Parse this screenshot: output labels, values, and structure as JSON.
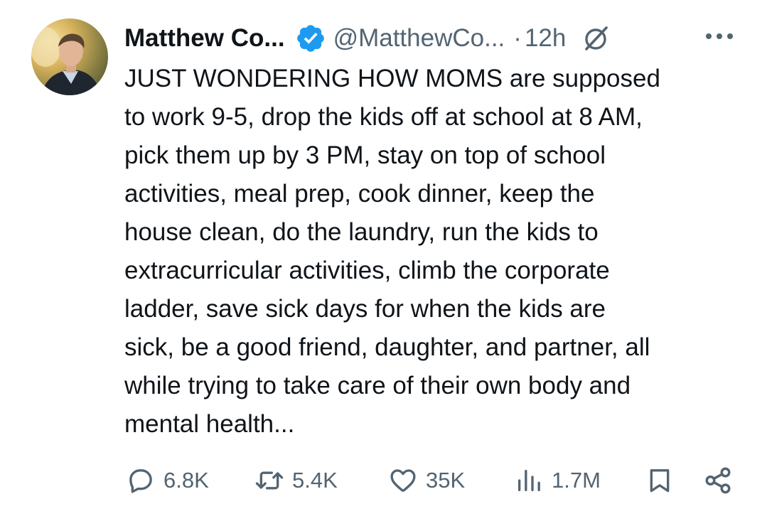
{
  "author": {
    "display_name": "Matthew Co...",
    "handle": "@MatthewCo...",
    "separator": "·",
    "time": "12h"
  },
  "tweet_text_lines": [
    "JUST WONDERING HOW MOMS are supposed",
    "to work 9-5, drop the kids off at school at 8 AM,",
    "pick them up by 3 PM, stay on top of school",
    "activities, meal prep, cook dinner, keep the",
    "house clean, do the laundry, run the kids to",
    "extracurricular activities, climb the corporate",
    "ladder, save sick days for when the kids are",
    "sick, be a good friend, daughter, and partner, all",
    "while trying to take care of their own body and",
    "mental health..."
  ],
  "actions": {
    "replies": "6.8K",
    "reposts": "5.4K",
    "likes": "35K",
    "views": "1.7M"
  },
  "icons": {
    "verified": "verified-badge-icon",
    "grok": "grok-icon",
    "more": "more-icon",
    "reply": "reply-icon",
    "repost": "repost-icon",
    "like": "like-icon",
    "views": "views-icon",
    "bookmark": "bookmark-icon",
    "share": "share-icon"
  },
  "colors": {
    "text": "#0f1419",
    "secondary": "#536471",
    "verified": "#1d9bf0"
  }
}
